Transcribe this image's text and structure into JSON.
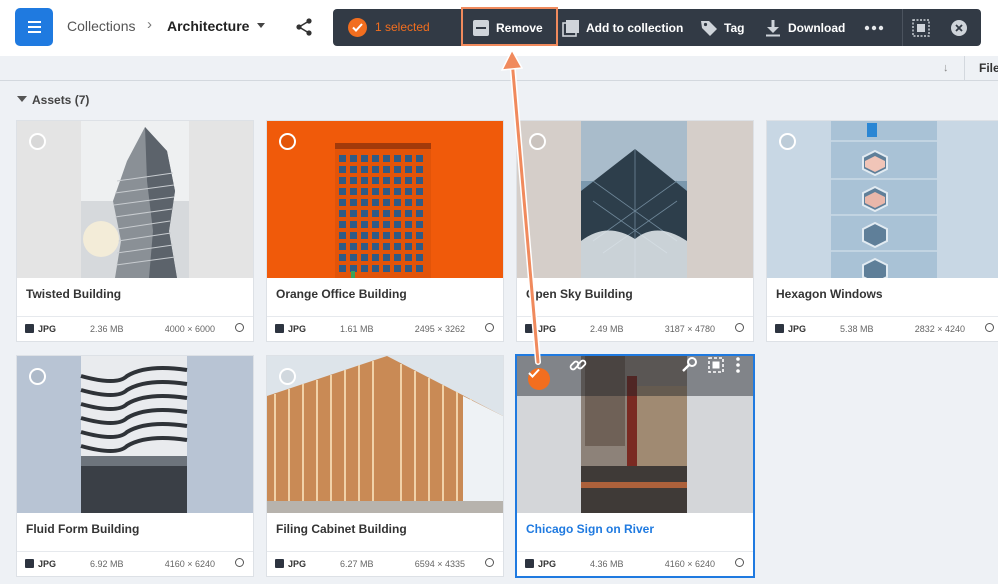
{
  "header": {
    "breadcrumb_root": "Collections",
    "breadcrumb_sep": "›",
    "breadcrumb_current": "Architecture"
  },
  "actionbar": {
    "selected_label": "1 selected",
    "remove_label": "Remove",
    "add_label": "Add to collection",
    "tag_label": "Tag",
    "download_label": "Download"
  },
  "columns": {
    "file_label": "File"
  },
  "section": {
    "title": "Assets (7)"
  },
  "assets": [
    {
      "title": "Twisted Building",
      "type": "JPG",
      "size": "2.36 MB",
      "dims": "4000 × 6000"
    },
    {
      "title": "Orange Office Building",
      "type": "JPG",
      "size": "1.61 MB",
      "dims": "2495 × 3262"
    },
    {
      "title": "Open Sky Building",
      "type": "JPG",
      "size": "2.49 MB",
      "dims": "3187 × 4780"
    },
    {
      "title": "Hexagon Windows",
      "type": "JPG",
      "size": "5.38 MB",
      "dims": "2832 × 4240"
    },
    {
      "title": "Fluid Form Building",
      "type": "JPG",
      "size": "6.92 MB",
      "dims": "4160 × 6240"
    },
    {
      "title": "Filing Cabinet Building",
      "type": "JPG",
      "size": "6.27 MB",
      "dims": "6594 × 4335"
    },
    {
      "title": "Chicago Sign on River",
      "type": "JPG",
      "size": "4.36 MB",
      "dims": "4160 × 6240"
    }
  ],
  "colors": {
    "accent": "#1f7ae0",
    "selection": "#f26e1f",
    "toolbar": "#323a45"
  }
}
